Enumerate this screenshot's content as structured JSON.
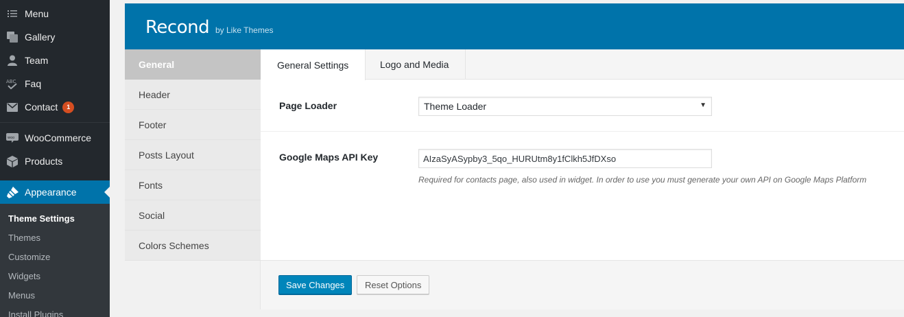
{
  "sidebar": {
    "items": [
      {
        "label": "Menu",
        "icon": "list-icon"
      },
      {
        "label": "Gallery",
        "icon": "gallery-icon"
      },
      {
        "label": "Team",
        "icon": "person-icon"
      },
      {
        "label": "Faq",
        "icon": "abc-check-icon"
      },
      {
        "label": "Contact",
        "icon": "mail-icon",
        "badge": "1"
      },
      {
        "label": "WooCommerce",
        "icon": "woocommerce-icon"
      },
      {
        "label": "Products",
        "icon": "box-icon"
      },
      {
        "label": "Appearance",
        "icon": "paintbrush-icon"
      }
    ],
    "submenu": [
      "Theme Settings",
      "Themes",
      "Customize",
      "Widgets",
      "Menus",
      "Install Plugins"
    ],
    "colors": {
      "bg": "#23282d",
      "active": "#0073aa",
      "badge": "#d54e21"
    }
  },
  "panel": {
    "theme_name": "Recond",
    "theme_by": "by Like Themes",
    "header_color": "#0073aa",
    "sections": [
      "General",
      "Header",
      "Footer",
      "Posts Layout",
      "Fonts",
      "Social",
      "Colors Schemes"
    ],
    "tabs": [
      "General Settings",
      "Logo and Media"
    ],
    "fields": {
      "page_loader": {
        "label": "Page Loader",
        "value": "Theme Loader"
      },
      "maps_key": {
        "label": "Google Maps API Key",
        "value": "AIzaSyASypby3_5qo_HURUtm8y1fClkh5JfDXso",
        "description": "Required for contacts page, also used in widget. In order to use you must generate your own API on Google Maps Platform"
      }
    },
    "buttons": {
      "save": "Save Changes",
      "reset": "Reset Options"
    }
  }
}
